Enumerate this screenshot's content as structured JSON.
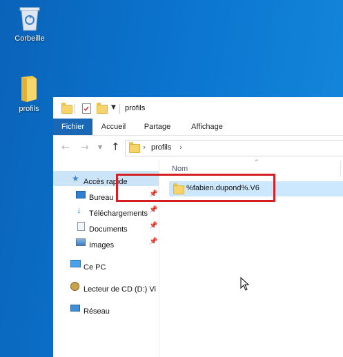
{
  "desktop": {
    "recycle_bin_label": "Corbeille",
    "folder_label": "profils"
  },
  "window": {
    "title": "profils",
    "tabs": [
      "Fichier",
      "Accueil",
      "Partage",
      "Affichage"
    ],
    "address": {
      "segment": "profils"
    },
    "nav": {
      "quick_access": "Accès rapide",
      "pinned": [
        "Bureau",
        "Téléchargements",
        "Documents",
        "Images"
      ],
      "this_pc": "Ce PC",
      "cd_drive": "Lecteur de CD (D:) Vi",
      "network": "Réseau"
    },
    "content": {
      "column_header": "Nom",
      "file_name": "%fabien.dupond%.V6"
    }
  },
  "colors": {
    "desktop_bg": "#0b74cf",
    "ribbon_active": "#1a67b5",
    "selection": "#cce8ff",
    "highlight_box": "#d41f26"
  }
}
